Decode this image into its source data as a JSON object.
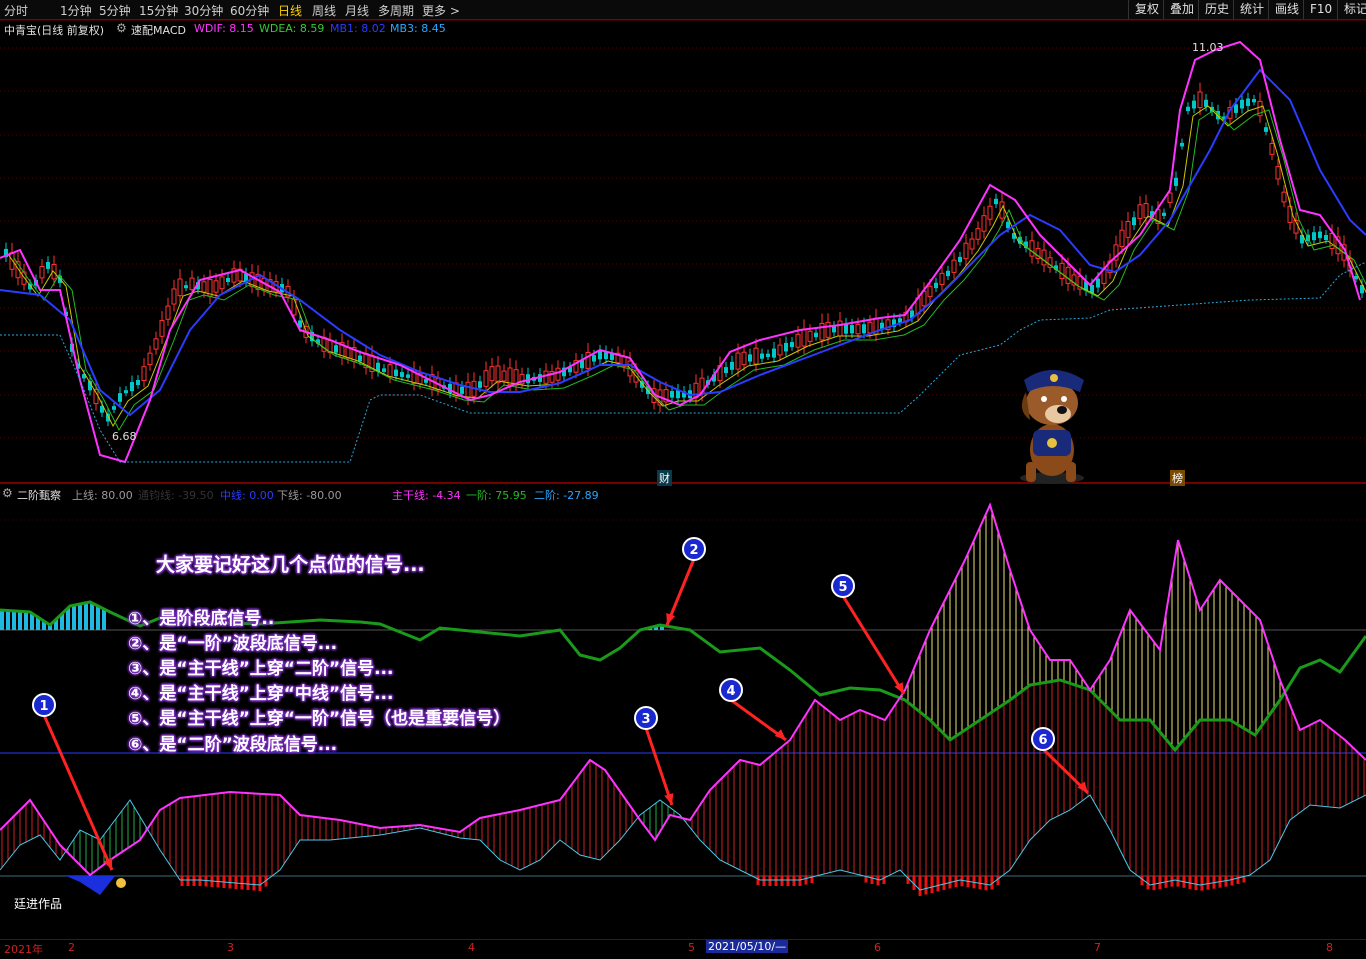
{
  "toolbar": {
    "periods": [
      "分时",
      "1分钟",
      "5分钟",
      "15分钟",
      "30分钟",
      "60分钟",
      "日线",
      "周线",
      "月线",
      "多周期",
      "更多 >"
    ],
    "active_period": "日线",
    "right_buttons": [
      "复权",
      "叠加",
      "历史",
      "统计",
      "画线",
      "F10",
      "标记"
    ]
  },
  "main_panel": {
    "stock": "中青宝(日线 前复权)",
    "indicator": "速配MACD",
    "wdif": "WDIF: 8.15",
    "wdea": "WDEA: 8.59",
    "mb1": "MB1: 8.02",
    "mb3": "MB3: 8.45",
    "high_label": "11.03",
    "low_label": "6.68",
    "marker_cai": "财",
    "marker_bang": "榜"
  },
  "sub_panel": {
    "name": "二阶甄察",
    "upper": "上线: 80.00",
    "mid2": "通钧线: -39.50",
    "middle": "中线: 0.00",
    "lower": "下线: -80.00",
    "main": "主干线: -4.34",
    "first": "一阶: 75.95",
    "second": "二阶: -27.89",
    "credit": "廷进作品"
  },
  "annotations": {
    "title": "大家要记好这几个点位的信号...",
    "items": [
      "①、是阶段底信号..",
      "②、是“一阶”波段底信号...",
      "③、是“主干线”上穿“二阶”信号...",
      "④、是“主干线”上穿“中线”信号...",
      "⑤、是“主干线”上穿“一阶”信号（也是重要信号）",
      "⑥、是“二阶”波段底信号..."
    ],
    "markers": [
      "1",
      "2",
      "3",
      "4",
      "5",
      "6"
    ]
  },
  "date_axis": {
    "labels": [
      "2021年",
      "2",
      "3",
      "4",
      "5",
      "2021/05/10/—",
      "6",
      "7",
      "8"
    ]
  },
  "colors": {
    "pink": "#ff33ff",
    "green_line": "#00cc00",
    "blue_line": "#2a3cff",
    "up_candle": "#ff3333",
    "down_candle": "#00c8c8",
    "annotation_shadow": "#7b2fbf",
    "arrow": "#ff2222"
  }
}
